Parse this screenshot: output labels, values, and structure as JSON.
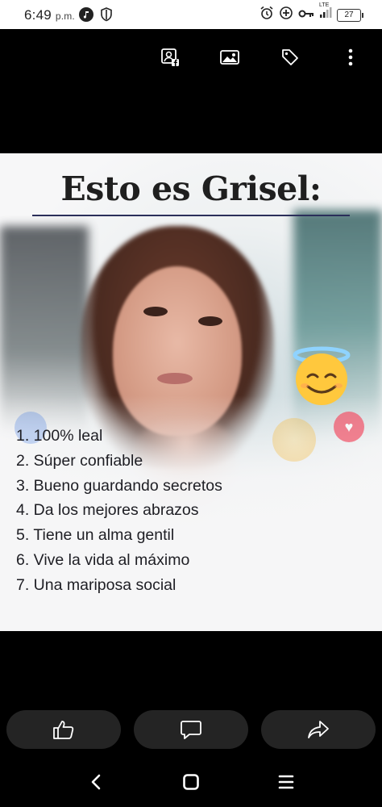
{
  "status_bar": {
    "time": "6:49",
    "ampm": "p.m.",
    "network": "LTE",
    "battery": "27",
    "icons_left": [
      "media-note-icon",
      "shield-icon"
    ],
    "icons_right": [
      "alarm-icon",
      "data-saver-icon",
      "vpn-key-icon",
      "signal-icon",
      "battery-icon"
    ]
  },
  "viewer_toolbar": {
    "icons": [
      "facebook-profile-picture-icon",
      "image-icon",
      "tag-icon",
      "more-vertical-icon"
    ]
  },
  "post_image": {
    "title": "Esto es Grisel:",
    "traits": [
      "1. 100% leal",
      "2. Súper confiable",
      "3. Bueno guardando secretos",
      "4. Da los mejores abrazos",
      "5. Tiene un alma gentil",
      "6. Vive la vida al máximo",
      "7. Una mariposa social"
    ],
    "emoji": "smiling-face-with-halo",
    "colors": {
      "title_rule": "#2b2f5a",
      "halo": "#8fd3ff",
      "emoji_face": "#ffc83d"
    }
  },
  "actions": {
    "icons": [
      "like-icon",
      "comment-icon",
      "share-icon"
    ],
    "background": "#242424"
  },
  "nav_bar": {
    "icons": [
      "back-icon",
      "home-icon",
      "recents-icon"
    ]
  }
}
